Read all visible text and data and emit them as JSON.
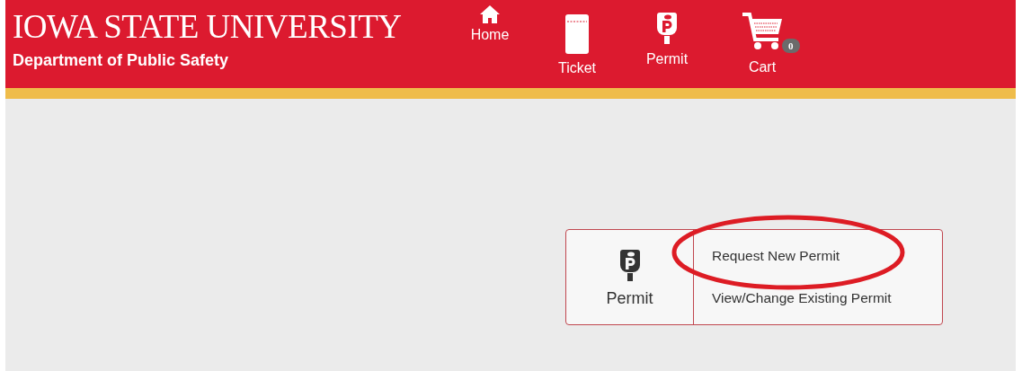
{
  "header": {
    "title": "IOWA STATE UNIVERSITY",
    "subtitle": "Department of Public Safety"
  },
  "nav": [
    {
      "kind": "home",
      "label": "Home"
    },
    {
      "kind": "ticket",
      "label": "Ticket"
    },
    {
      "kind": "permit",
      "label": "Permit"
    },
    {
      "kind": "cart",
      "label": "Cart",
      "badge": "0"
    }
  ],
  "card": {
    "label": "Permit",
    "options": [
      {
        "label": "Request New Permit",
        "circled": true
      },
      {
        "label": "View/Change Existing Permit",
        "circled": false
      }
    ]
  }
}
